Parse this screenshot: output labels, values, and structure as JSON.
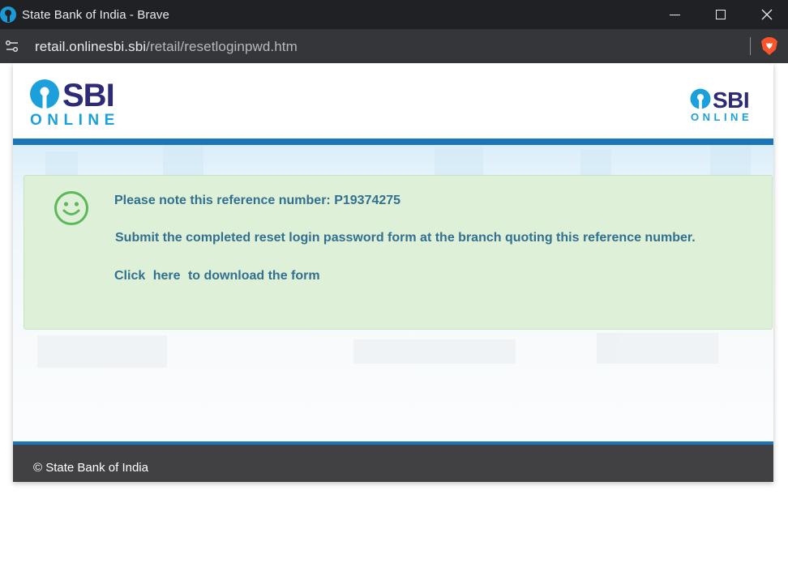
{
  "window": {
    "title": "State Bank of India - Brave",
    "favicon_icon": "sbi-favicon-icon"
  },
  "address_bar": {
    "host": "retail.onlinesbi.sbi",
    "path": "/retail/resetloginpwd.htm"
  },
  "header": {
    "logo_text": "SBI",
    "logo_subtext": "ONLINE"
  },
  "notice": {
    "icon": "smiley-icon",
    "reference_line": "Please note this reference number: P19374275",
    "instruction_line": "Submit the completed reset login password form at the branch quoting this reference number.",
    "click_label": "Click",
    "link_label": "here",
    "download_suffix": "to download the form"
  },
  "footer": {
    "copyright": "© State Bank of India"
  },
  "colors": {
    "brand_blue": "#1b75bb",
    "logo_cyan": "#1ba0db",
    "logo_navy": "#2c2a79",
    "notice_bg": "#dff0d8",
    "notice_text": "#31708f",
    "smiley": "#5cb85c",
    "footer_bg": "#414042"
  }
}
